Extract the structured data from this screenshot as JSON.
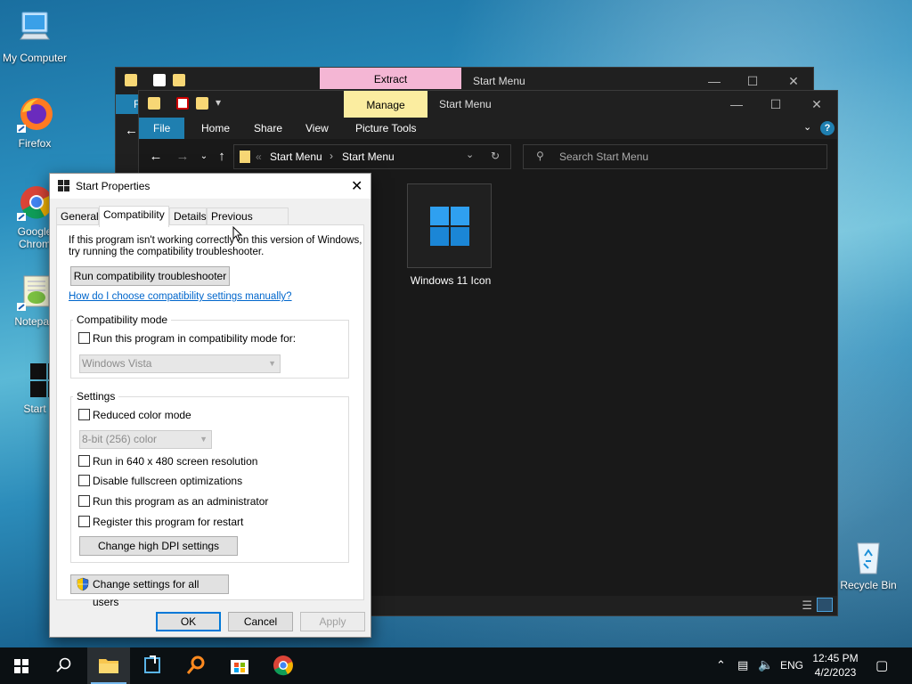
{
  "desktop": {
    "icons": [
      {
        "label": "My Computer"
      },
      {
        "label": "Firefox"
      },
      {
        "label": "Google Chrom"
      },
      {
        "label": "Notepad"
      },
      {
        "label": "Start"
      },
      {
        "label": "Recycle Bin"
      }
    ]
  },
  "explorer_back": {
    "context_tab": "Extract",
    "title": "Start Menu",
    "partial_tab": "F"
  },
  "explorer_front": {
    "context_tab": "Manage",
    "title": "Start Menu",
    "ribbon_tabs": [
      "File",
      "Home",
      "Share",
      "View",
      "Picture Tools"
    ],
    "address": {
      "prefix": "«",
      "parts": [
        "Start Menu",
        "Start Menu"
      ]
    },
    "search_placeholder": "Search Start Menu",
    "file": {
      "name": "Windows 11 Icon"
    },
    "help_label": "?"
  },
  "dialog": {
    "title": "Start Properties",
    "tabs": [
      "General",
      "Compatibility",
      "Details",
      "Previous Versions"
    ],
    "active_tab": "Compatibility",
    "intro_line1": "If this program isn't working correctly on this version of Windows,",
    "intro_line2": "try running the compatibility troubleshooter.",
    "troubleshooter_button": "Run compatibility troubleshooter",
    "help_link": "How do I choose compatibility settings manually?",
    "compat_group": {
      "label": "Compatibility mode",
      "checkbox": "Run this program in compatibility mode for:",
      "select_value": "Windows Vista"
    },
    "settings_group": {
      "label": "Settings",
      "reduced_color": "Reduced color mode",
      "color_select": "8-bit (256) color",
      "res_640": "Run in 640 x 480 screen resolution",
      "fullscreen_opt": "Disable fullscreen optimizations",
      "admin": "Run this program as an administrator",
      "restart": "Register this program for restart",
      "dpi_button": "Change high DPI settings"
    },
    "all_users_button": "Change settings for all users",
    "ok": "OK",
    "cancel": "Cancel",
    "apply": "Apply"
  },
  "taskbar": {
    "language": "ENG",
    "time": "12:45 PM",
    "date": "4/2/2023"
  },
  "colors": {
    "accent": "#0078d7",
    "file_tab": "#1f7fb0",
    "extract_tab": "#f4b6d4",
    "manage_tab": "#fbeda0"
  }
}
